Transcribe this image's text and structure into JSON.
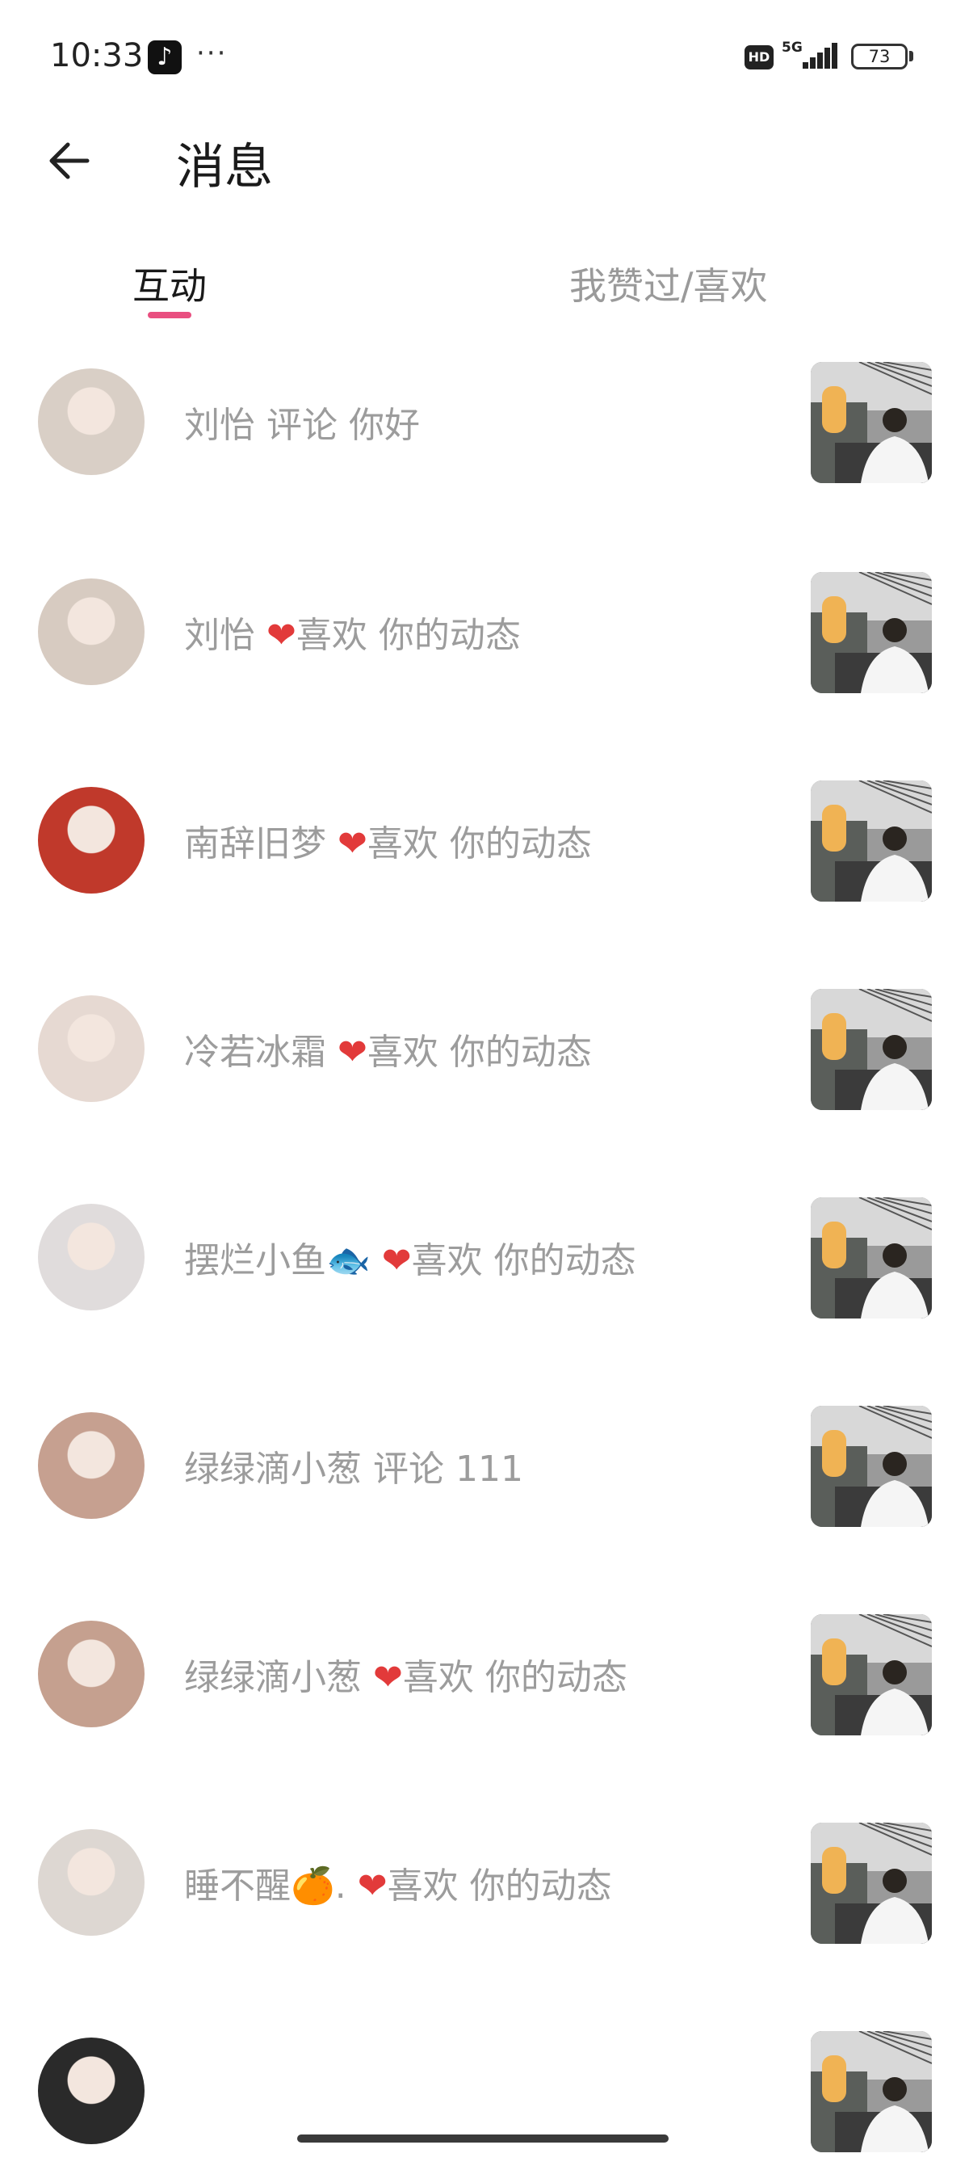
{
  "status_bar": {
    "time": "10:33",
    "tiktok_glyph": "♪",
    "more": "···",
    "hd": "HD",
    "network": "5G",
    "battery": "73"
  },
  "header": {
    "title": "消息",
    "back_icon": "arrow-left-icon"
  },
  "tabs": [
    {
      "label": "互动",
      "active": true
    },
    {
      "label": "我赞过/喜欢",
      "active": false
    }
  ],
  "colors": {
    "accent": "#e94f80",
    "heart": "#e23a3a",
    "muted_text": "#9c9c9c"
  },
  "messages": [
    {
      "name": "刘怡",
      "heart": "",
      "action": "评论",
      "text": "你好",
      "avatar_color": "#d9cfc6"
    },
    {
      "name": "刘怡",
      "heart": "❤",
      "action": "喜欢",
      "text": "你的动态",
      "avatar_color": "#d7cbc1"
    },
    {
      "name": "南辞旧梦",
      "heart": "❤",
      "action": "喜欢",
      "text": "你的动态",
      "avatar_color": "#c0392b"
    },
    {
      "name": "冷若冰霜",
      "heart": "❤",
      "action": "喜欢",
      "text": "你的动态",
      "avatar_color": "#e6d9d2"
    },
    {
      "name": "摆烂小鱼🐟",
      "heart": "❤",
      "action": "喜欢",
      "text": "你的动态",
      "avatar_color": "#e0dcdc"
    },
    {
      "name": "绿绿滴小葱",
      "heart": "",
      "action": "评论",
      "text": "111",
      "avatar_color": "#c6a090"
    },
    {
      "name": "绿绿滴小葱",
      "heart": "❤",
      "action": "喜欢",
      "text": "你的动态",
      "avatar_color": "#c5a08f"
    },
    {
      "name": "睡不醒🍊.",
      "heart": "❤",
      "action": "喜欢",
      "text": "你的动态",
      "avatar_color": "#ddd7d2"
    },
    {
      "name": "",
      "heart": "",
      "action": "",
      "text": "",
      "avatar_color": "#2a2a2a"
    }
  ]
}
